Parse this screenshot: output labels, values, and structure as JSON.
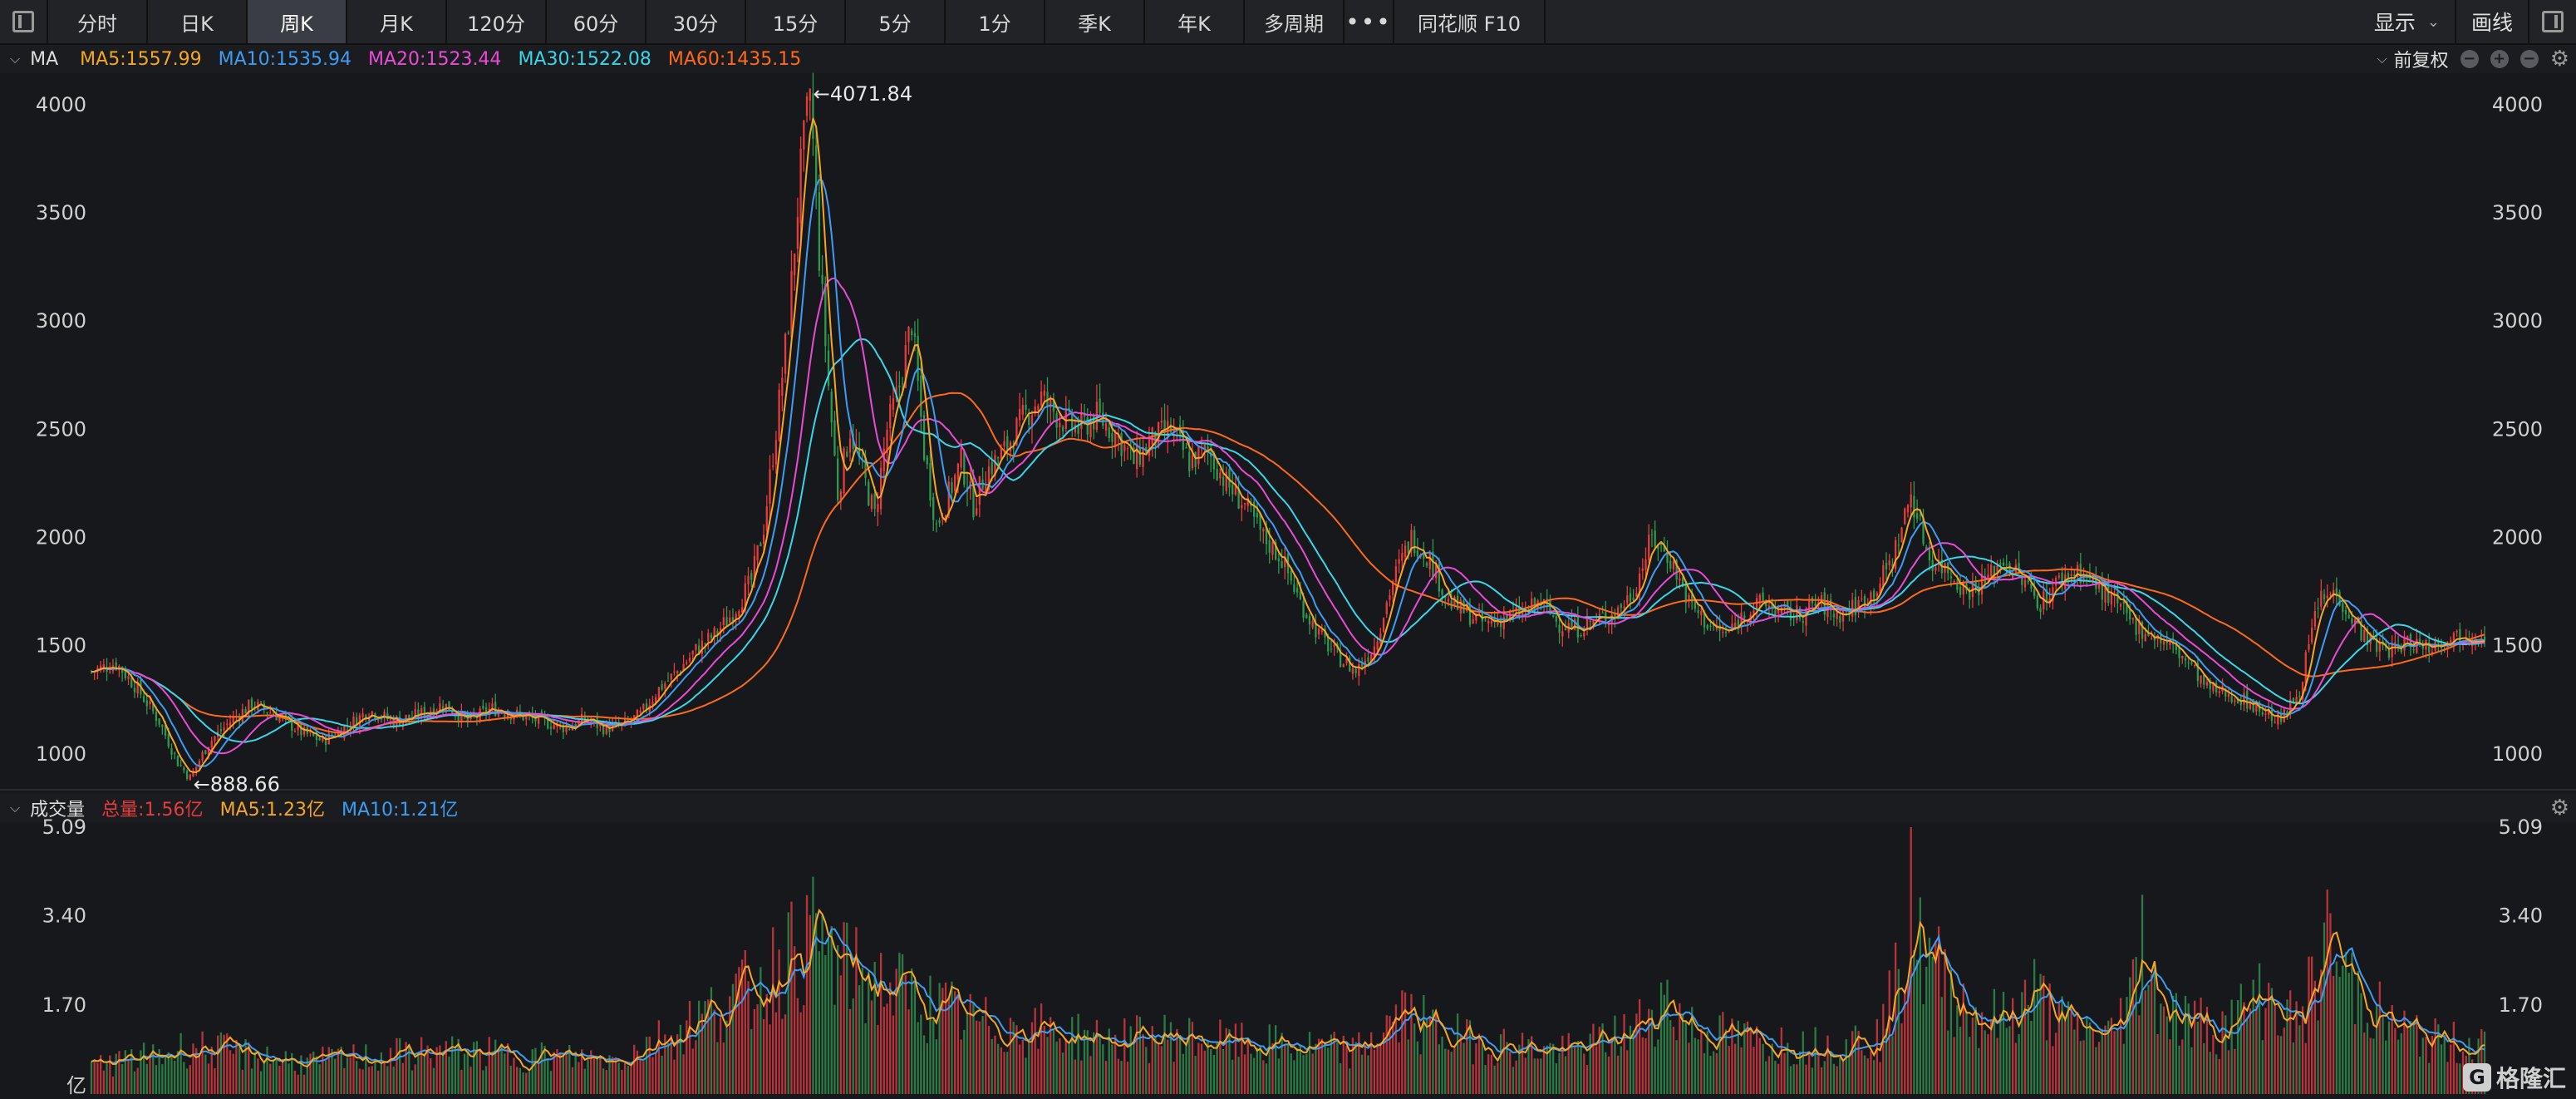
{
  "toolbar": {
    "tabs": [
      "分时",
      "日K",
      "周K",
      "月K",
      "120分",
      "60分",
      "30分",
      "15分",
      "5分",
      "1分",
      "季K",
      "年K",
      "多周期"
    ],
    "active_tab": "周K",
    "more": "•••",
    "f10": "同花顺 F10",
    "display": "显示",
    "draw": "画线"
  },
  "price_legend": {
    "name": "MA",
    "ma5": "MA5:1557.99",
    "ma10": "MA10:1535.94",
    "ma20": "MA20:1523.44",
    "ma30": "MA30:1522.08",
    "ma60": "MA60:1435.15",
    "adjust": "前复权"
  },
  "volume_legend": {
    "name": "成交量",
    "total": "总量:1.56亿",
    "ma5": "MA5:1.23亿",
    "ma10": "MA10:1.21亿"
  },
  "colors": {
    "up": "#e63c3c",
    "down": "#2e9a4e",
    "ma5": "#f5a623",
    "ma10": "#3d9df3",
    "ma20": "#e94bd6",
    "ma30": "#38d6e8",
    "ma60": "#ff6a1a"
  },
  "logo": "格隆汇",
  "chart_data": [
    {
      "type": "candlestick",
      "y_ticks": [
        "4000",
        "3500",
        "3000",
        "2500",
        "2000",
        "1500",
        "1000"
      ],
      "ylim": [
        880,
        4130
      ],
      "annotations": [
        {
          "label": "←4071.84",
          "value": 4071.84
        },
        {
          "label": "←888.66",
          "value": 888.66
        }
      ],
      "close_path": [
        [
          0,
          1380
        ],
        [
          8,
          1420
        ],
        [
          15,
          1300
        ],
        [
          22,
          1150
        ],
        [
          28,
          960
        ],
        [
          32,
          888.66
        ],
        [
          38,
          1050
        ],
        [
          45,
          1150
        ],
        [
          52,
          1230
        ],
        [
          60,
          1180
        ],
        [
          68,
          1100
        ],
        [
          75,
          1060
        ],
        [
          82,
          1120
        ],
        [
          90,
          1200
        ],
        [
          98,
          1150
        ],
        [
          106,
          1180
        ],
        [
          114,
          1230
        ],
        [
          122,
          1150
        ],
        [
          130,
          1210
        ],
        [
          138,
          1180
        ],
        [
          146,
          1150
        ],
        [
          154,
          1120
        ],
        [
          160,
          1160
        ],
        [
          166,
          1120
        ],
        [
          172,
          1130
        ],
        [
          178,
          1180
        ],
        [
          184,
          1300
        ],
        [
          190,
          1380
        ],
        [
          196,
          1480
        ],
        [
          202,
          1550
        ],
        [
          208,
          1650
        ],
        [
          214,
          1800
        ],
        [
          218,
          2050
        ],
        [
          222,
          2500
        ],
        [
          226,
          3000
        ],
        [
          230,
          3700
        ],
        [
          233,
          4071.84
        ],
        [
          236,
          3300
        ],
        [
          239,
          2700
        ],
        [
          242,
          2200
        ],
        [
          246,
          2500
        ],
        [
          250,
          2300
        ],
        [
          254,
          2100
        ],
        [
          258,
          2500
        ],
        [
          262,
          2700
        ],
        [
          266,
          3000
        ],
        [
          270,
          2400
        ],
        [
          274,
          2050
        ],
        [
          278,
          2200
        ],
        [
          282,
          2350
        ],
        [
          286,
          2150
        ],
        [
          290,
          2300
        ],
        [
          296,
          2400
        ],
        [
          302,
          2550
        ],
        [
          308,
          2650
        ],
        [
          314,
          2550
        ],
        [
          320,
          2500
        ],
        [
          326,
          2560
        ],
        [
          332,
          2480
        ],
        [
          338,
          2350
        ],
        [
          344,
          2450
        ],
        [
          350,
          2500
        ],
        [
          356,
          2350
        ],
        [
          362,
          2400
        ],
        [
          368,
          2250
        ],
        [
          374,
          2150
        ],
        [
          380,
          2000
        ],
        [
          386,
          1900
        ],
        [
          392,
          1700
        ],
        [
          398,
          1550
        ],
        [
          404,
          1450
        ],
        [
          410,
          1380
        ],
        [
          416,
          1500
        ],
        [
          422,
          1800
        ],
        [
          428,
          2000
        ],
        [
          434,
          1900
        ],
        [
          440,
          1700
        ],
        [
          446,
          1650
        ],
        [
          452,
          1600
        ],
        [
          458,
          1630
        ],
        [
          464,
          1650
        ],
        [
          470,
          1700
        ],
        [
          476,
          1600
        ],
        [
          482,
          1580
        ],
        [
          488,
          1620
        ],
        [
          494,
          1650
        ],
        [
          500,
          1750
        ],
        [
          506,
          2000
        ],
        [
          512,
          1900
        ],
        [
          518,
          1700
        ],
        [
          524,
          1600
        ],
        [
          530,
          1550
        ],
        [
          536,
          1650
        ],
        [
          542,
          1700
        ],
        [
          548,
          1650
        ],
        [
          554,
          1640
        ],
        [
          560,
          1700
        ],
        [
          566,
          1640
        ],
        [
          572,
          1680
        ],
        [
          578,
          1750
        ],
        [
          584,
          1900
        ],
        [
          590,
          2200
        ],
        [
          596,
          1900
        ],
        [
          602,
          1850
        ],
        [
          608,
          1750
        ],
        [
          614,
          1800
        ],
        [
          620,
          1900
        ],
        [
          626,
          1800
        ],
        [
          632,
          1700
        ],
        [
          638,
          1800
        ],
        [
          644,
          1850
        ],
        [
          650,
          1780
        ],
        [
          656,
          1700
        ],
        [
          662,
          1600
        ],
        [
          668,
          1550
        ],
        [
          674,
          1500
        ],
        [
          680,
          1420
        ],
        [
          686,
          1300
        ],
        [
          692,
          1280
        ],
        [
          698,
          1250
        ],
        [
          704,
          1200
        ],
        [
          710,
          1150
        ],
        [
          716,
          1300
        ],
        [
          722,
          1700
        ],
        [
          728,
          1750
        ],
        [
          734,
          1600
        ],
        [
          740,
          1500
        ],
        [
          746,
          1480
        ],
        [
          752,
          1520
        ],
        [
          758,
          1500
        ],
        [
          764,
          1540
        ],
        [
          770,
          1550
        ],
        [
          776,
          1557
        ]
      ]
    },
    {
      "type": "bar",
      "y_ticks": [
        "5.09",
        "3.40",
        "1.70",
        "亿"
      ],
      "ylim": [
        0,
        5.09
      ],
      "unit": "亿",
      "volume_path": [
        [
          0,
          0.55
        ],
        [
          20,
          0.7
        ],
        [
          32,
          0.9
        ],
        [
          50,
          0.75
        ],
        [
          70,
          0.6
        ],
        [
          90,
          0.7
        ],
        [
          110,
          0.8
        ],
        [
          130,
          0.75
        ],
        [
          150,
          0.7
        ],
        [
          170,
          0.65
        ],
        [
          190,
          1.2
        ],
        [
          205,
          1.7
        ],
        [
          215,
          2.0
        ],
        [
          225,
          2.6
        ],
        [
          235,
          2.9
        ],
        [
          245,
          2.3
        ],
        [
          260,
          2.0
        ],
        [
          275,
          1.6
        ],
        [
          290,
          1.3
        ],
        [
          310,
          1.2
        ],
        [
          330,
          1.0
        ],
        [
          350,
          1.1
        ],
        [
          370,
          0.95
        ],
        [
          390,
          0.9
        ],
        [
          410,
          0.8
        ],
        [
          425,
          1.5
        ],
        [
          440,
          1.1
        ],
        [
          460,
          0.9
        ],
        [
          480,
          0.8
        ],
        [
          500,
          1.2
        ],
        [
          510,
          1.8
        ],
        [
          520,
          1.2
        ],
        [
          540,
          1.0
        ],
        [
          560,
          0.9
        ],
        [
          580,
          1.1
        ],
        [
          590,
          2.9
        ],
        [
          600,
          2.2
        ],
        [
          610,
          1.5
        ],
        [
          620,
          1.4
        ],
        [
          630,
          1.9
        ],
        [
          640,
          1.3
        ],
        [
          655,
          1.1
        ],
        [
          665,
          2.4
        ],
        [
          675,
          1.5
        ],
        [
          690,
          1.2
        ],
        [
          705,
          1.9
        ],
        [
          715,
          1.3
        ],
        [
          725,
          2.6
        ],
        [
          735,
          2.0
        ],
        [
          745,
          1.3
        ],
        [
          760,
          1.0
        ],
        [
          776,
          0.9
        ]
      ]
    }
  ]
}
